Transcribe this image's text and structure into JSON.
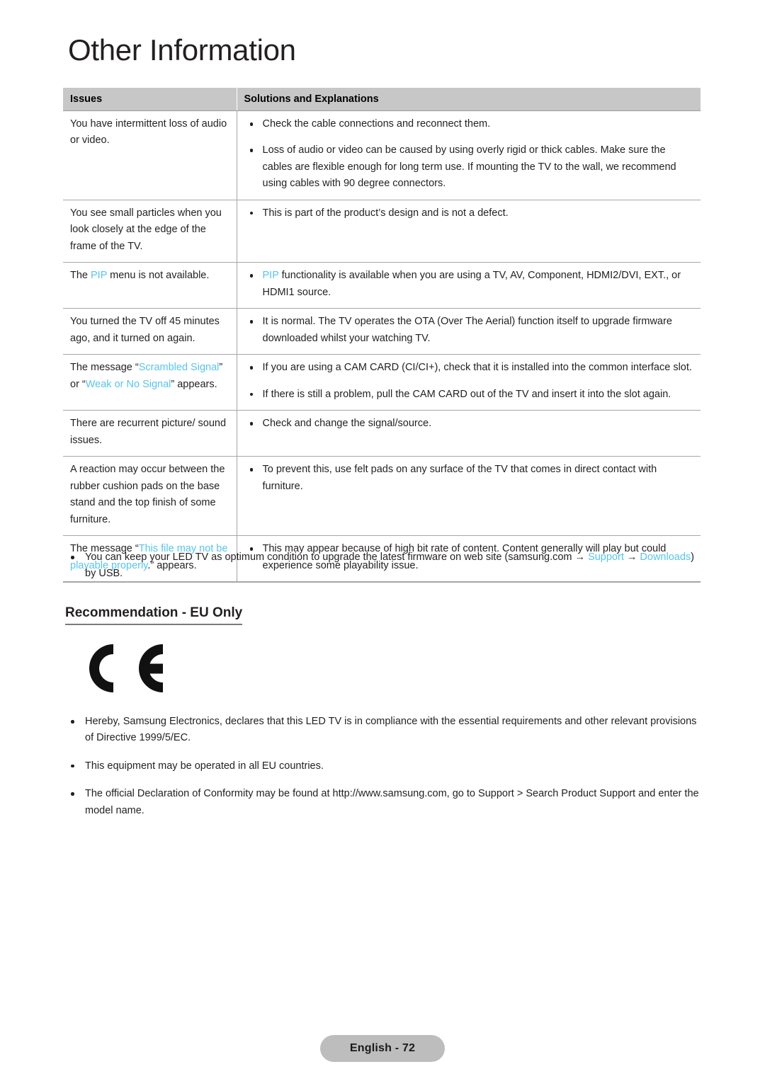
{
  "page": {
    "title": "Other Information",
    "footer_label": "English - 72"
  },
  "table": {
    "headers": {
      "issues": "Issues",
      "solutions": "Solutions and Explanations"
    },
    "rows": [
      {
        "issue_parts": [
          {
            "text": "You have intermittent loss of audio or video.",
            "highlight": false
          }
        ],
        "solutions": [
          [
            {
              "text": "Check the cable connections and reconnect them.",
              "highlight": false
            }
          ],
          [
            {
              "text": "Loss of audio or video can be caused by using overly rigid or thick cables. Make sure the cables are flexible enough for long term use. If mounting the TV to the wall, we recommend using cables with 90 degree connectors.",
              "highlight": false
            }
          ]
        ]
      },
      {
        "issue_parts": [
          {
            "text": "You see small particles when you look closely at the edge of the frame of the TV.",
            "highlight": false
          }
        ],
        "solutions": [
          [
            {
              "text": "This is part of the product’s design and is not a defect.",
              "highlight": false
            }
          ]
        ]
      },
      {
        "issue_parts": [
          {
            "text": "The ",
            "highlight": false
          },
          {
            "text": "PIP",
            "highlight": true
          },
          {
            "text": " menu is not available.",
            "highlight": false
          }
        ],
        "solutions": [
          [
            {
              "text": "PIP",
              "highlight": true
            },
            {
              "text": " functionality is available when you are using a TV,  AV, Component, HDMI2/DVI, EXT., or HDMI1 source.",
              "highlight": false
            }
          ]
        ]
      },
      {
        "issue_parts": [
          {
            "text": "You turned the TV off 45 minutes ago, and it turned on again.",
            "highlight": false
          }
        ],
        "solutions": [
          [
            {
              "text": "It is normal. The TV operates the OTA (Over The Aerial) function itself to upgrade firmware downloaded whilst your watching TV.",
              "highlight": false
            }
          ]
        ]
      },
      {
        "issue_parts": [
          {
            "text": "The message “",
            "highlight": false
          },
          {
            "text": "Scrambled Signal",
            "highlight": true
          },
          {
            "text": "” or “",
            "highlight": false
          },
          {
            "text": "Weak or No Signal",
            "highlight": true
          },
          {
            "text": "” appears.",
            "highlight": false
          }
        ],
        "solutions": [
          [
            {
              "text": "If you are using a CAM CARD (CI/CI+), check that it is installed into the common interface slot.",
              "highlight": false
            }
          ],
          [
            {
              "text": "If there is still a problem, pull the CAM CARD out of the TV and insert it into the slot again.",
              "highlight": false
            }
          ]
        ]
      },
      {
        "issue_parts": [
          {
            "text": "There are recurrent picture/ sound issues.",
            "highlight": false
          }
        ],
        "solutions": [
          [
            {
              "text": "Check and change the signal/source.",
              "highlight": false
            }
          ]
        ]
      },
      {
        "issue_parts": [
          {
            "text": "A reaction may occur between the rubber cushion pads on the base stand and the top finish of some furniture.",
            "highlight": false
          }
        ],
        "solutions": [
          [
            {
              "text": "To prevent this, use felt pads on any surface of the TV that comes in direct contact with furniture.",
              "highlight": false
            }
          ]
        ]
      },
      {
        "issue_parts": [
          {
            "text": "The message “",
            "highlight": false
          },
          {
            "text": "This file may not be playable properly",
            "highlight": true
          },
          {
            "text": ".” appears.",
            "highlight": false
          }
        ],
        "solutions": [
          [
            {
              "text": "This may appear because of high bit rate of content. Content generally will play but could experience some playability issue.",
              "highlight": false
            }
          ]
        ]
      }
    ]
  },
  "note": {
    "items": [
      [
        {
          "text": "You can keep your LED TV as optimum condition to upgrade the latest firmware on web site (samsung.com → ",
          "highlight": false
        },
        {
          "text": "Support",
          "highlight": true
        },
        {
          "text": " → ",
          "highlight": false
        },
        {
          "text": "Downloads",
          "highlight": true
        },
        {
          "text": ") by USB.",
          "highlight": false
        }
      ]
    ]
  },
  "eu_section": {
    "heading": "Recommendation - EU Only",
    "ce_mark_label": "CE",
    "items": [
      [
        {
          "text": "Hereby, Samsung Electronics, declares that this LED TV is in compliance with the essential requirements and other relevant provisions of Directive 1999/5/EC.",
          "highlight": false
        }
      ],
      [
        {
          "text": "This equipment may be operated in all EU countries.",
          "highlight": false
        }
      ],
      [
        {
          "text": "The official Declaration of Conformity may be found at http://www.samsung.com, go to Support > Search Product Support and enter the model name.",
          "highlight": false
        }
      ]
    ]
  },
  "colors": {
    "highlight": "#56c5ef",
    "header_bg": "#c7c7c7",
    "rule": "#a6a6a6",
    "footer_bg": "#bdbdbd"
  }
}
